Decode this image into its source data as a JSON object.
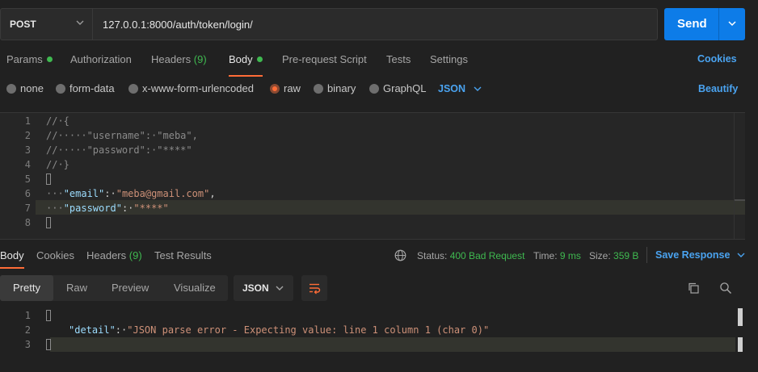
{
  "request": {
    "method": "POST",
    "url": "127.0.0.1:8000/auth/token/login/",
    "send_label": "Send"
  },
  "tabs": [
    {
      "label": "Params"
    },
    {
      "label": "Authorization"
    },
    {
      "label": "Headers",
      "count": "(9)"
    },
    {
      "label": "Body"
    },
    {
      "label": "Pre-request Script"
    },
    {
      "label": "Tests"
    },
    {
      "label": "Settings"
    }
  ],
  "cookies_label": "Cookies",
  "body_types": [
    "none",
    "form-data",
    "x-www-form-urlencoded",
    "raw",
    "binary",
    "GraphQL"
  ],
  "body_format": "JSON",
  "beautify_label": "Beautify",
  "editor": {
    "line_numbers": [
      "1",
      "2",
      "3",
      "4",
      "5",
      "6",
      "7",
      "8"
    ],
    "comment1": "//·{",
    "comment2_prefix": "//·····\"username\":·\"meba\",",
    "comment3_prefix": "//·····\"password\":·\"****\"",
    "comment4": "//·}",
    "indent": "···",
    "email_key": "\"email\"",
    "email_val": "\"meba@gmail.com\"",
    "password_key": "\"password\"",
    "password_val": "\"****\"",
    "colon": ":·",
    "comma": ","
  },
  "response": {
    "tabs": [
      {
        "label": "Body"
      },
      {
        "label": "Cookies"
      },
      {
        "label": "Headers",
        "count": "(9)"
      },
      {
        "label": "Test Results"
      }
    ],
    "status_label": "Status:",
    "status_value": "400 Bad Request",
    "time_label": "Time:",
    "time_value": "9 ms",
    "size_label": "Size:",
    "size_value": "359 B",
    "save_label": "Save Response",
    "views": [
      "Pretty",
      "Raw",
      "Preview",
      "Visualize"
    ],
    "format": "JSON",
    "line_numbers": [
      "1",
      "2",
      "3"
    ],
    "detail_key": "\"detail\"",
    "detail_val": "\"JSON parse error - Expecting value: line 1 column 1 (char 0)\""
  },
  "colors": {
    "accent": "#ff6c37",
    "send": "#0d7ce8",
    "ok": "#3fb950",
    "link": "#4aa3f0"
  }
}
